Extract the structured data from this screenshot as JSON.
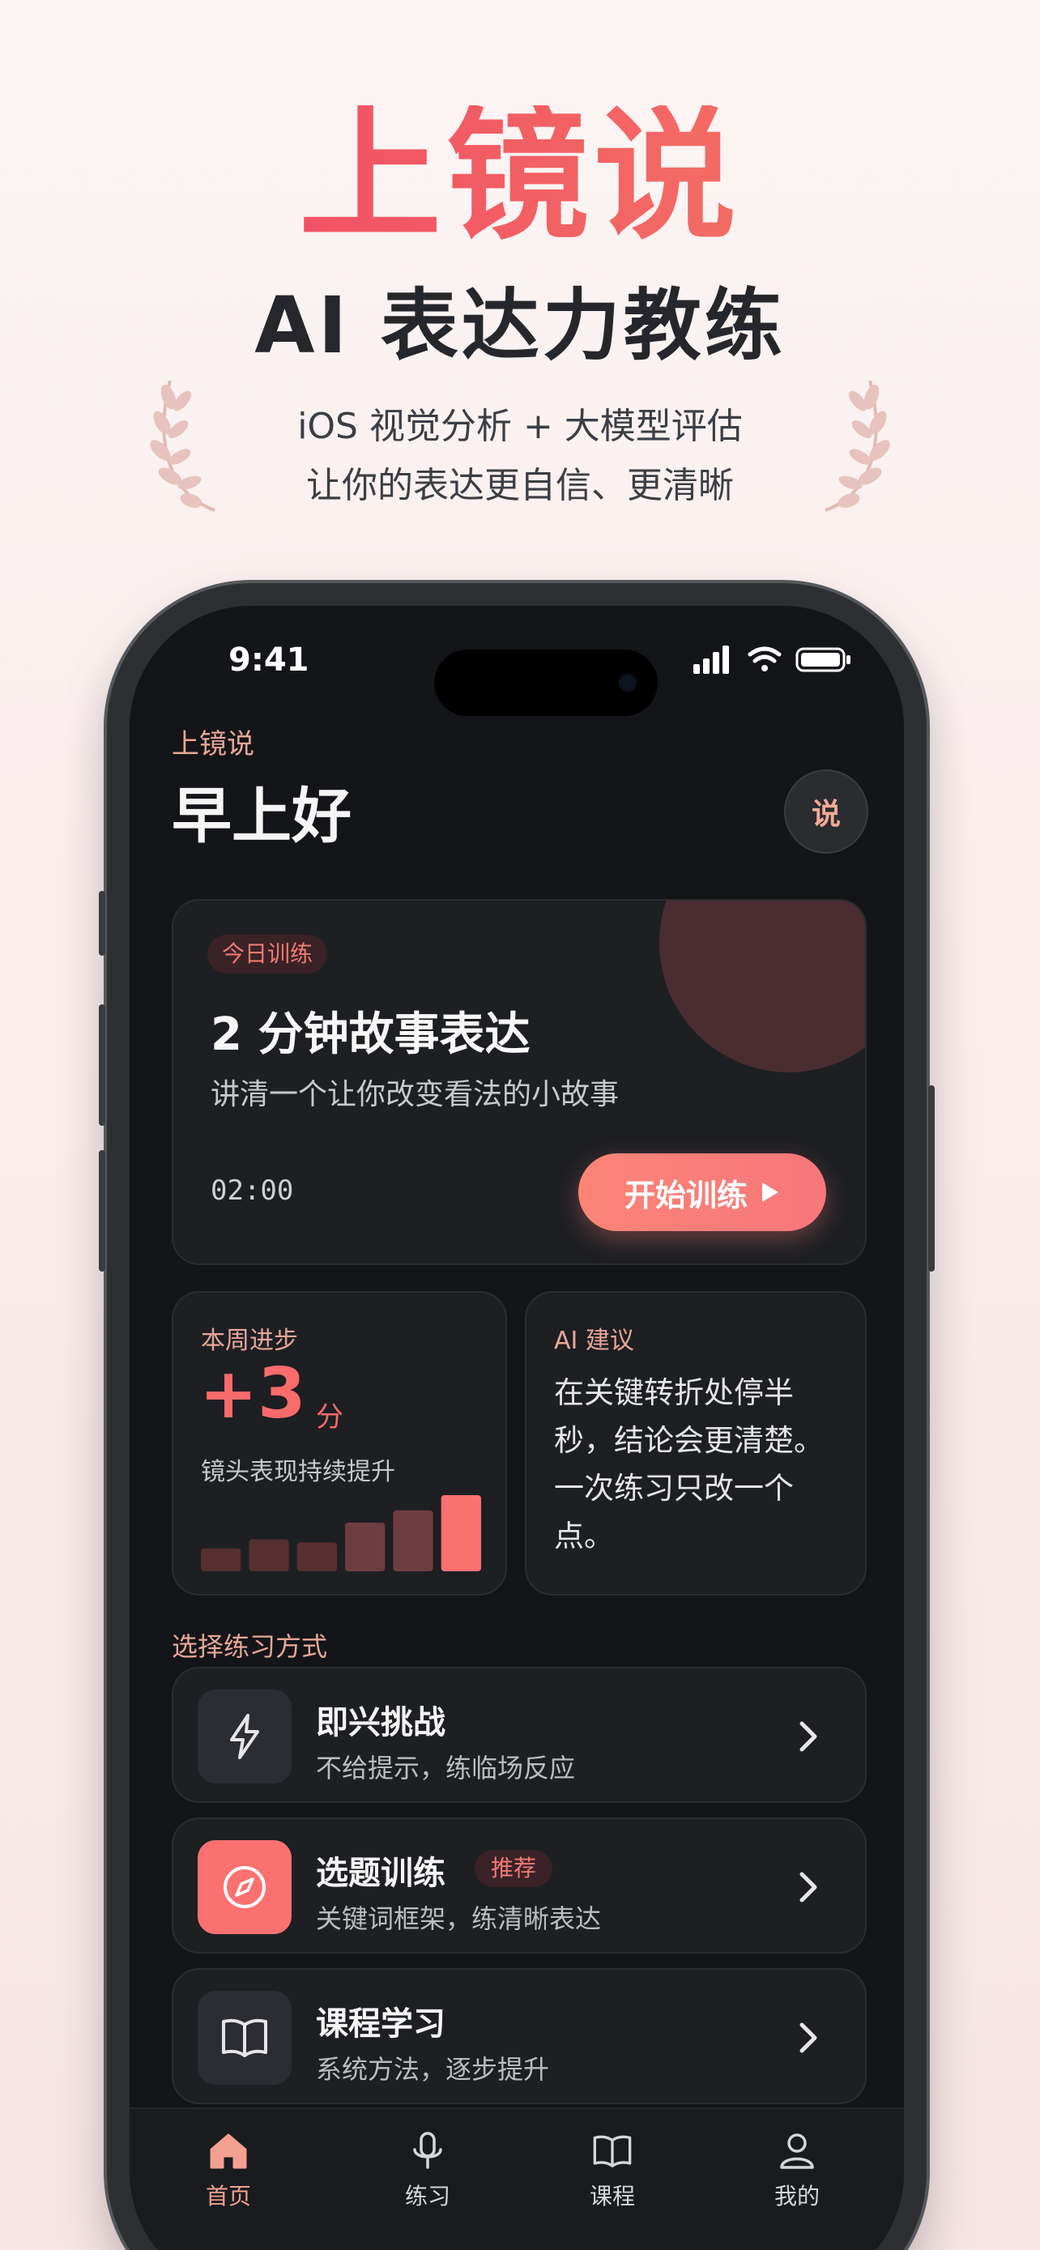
{
  "hero": {
    "title": "上镜说",
    "subtitle": "AI 表达力教练",
    "line1": "iOS 视觉分析 + 大模型评估",
    "line2": "让你的表达更自信、更清晰"
  },
  "status_bar": {
    "time": "9:41"
  },
  "header": {
    "brand": "上镜说",
    "greeting": "早上好",
    "avatar_text": "说"
  },
  "today_card": {
    "badge": "今日训练",
    "title": "2 分钟故事表达",
    "description": "讲清一个让你改变看法的小故事",
    "timer": "02:00",
    "start_label": "开始训练"
  },
  "weekly": {
    "label": "本周进步",
    "value": "+3",
    "unit": "分",
    "description": "镜头表现持续提升",
    "bars": [
      0.3,
      0.42,
      0.38,
      0.64,
      0.8,
      1.0
    ]
  },
  "advice": {
    "label": "AI 建议",
    "text": "在关键转折处停半秒，结论会更清楚。一次练习只改一个点。"
  },
  "modes": {
    "section_title": "选择练习方式",
    "items": [
      {
        "title": "即兴挑战",
        "description": "不给提示，练临场反应",
        "icon": "lightning-icon"
      },
      {
        "title": "选题训练",
        "tag": "推荐",
        "description": "关键词框架，练清晰表达",
        "icon": "compass-icon"
      },
      {
        "title": "课程学习",
        "description": "系统方法，逐步提升",
        "icon": "book-icon"
      }
    ]
  },
  "tabbar": {
    "items": [
      {
        "label": "首页",
        "icon": "home-icon"
      },
      {
        "label": "练习",
        "icon": "microphone-icon"
      },
      {
        "label": "课程",
        "icon": "book-icon"
      },
      {
        "label": "我的",
        "icon": "person-icon"
      }
    ]
  },
  "colors": {
    "accent": "#fa7170",
    "accent_soft": "#e8a797",
    "background_dark": "#141518",
    "card": "#1d1f23"
  }
}
